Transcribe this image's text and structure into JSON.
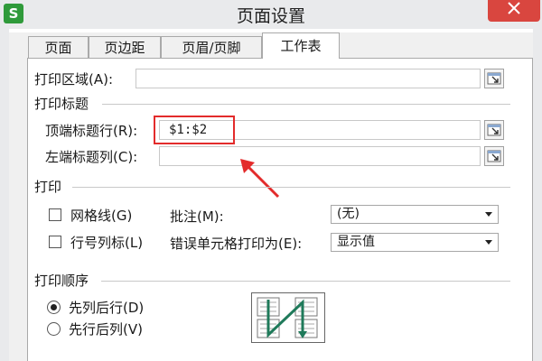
{
  "window": {
    "title": "页面设置",
    "app_icon_letter": "S"
  },
  "tabs": [
    {
      "label": "页面",
      "active": false
    },
    {
      "label": "页边距",
      "active": false
    },
    {
      "label": "页眉/页脚",
      "active": false
    },
    {
      "label": "工作表",
      "active": true
    }
  ],
  "print_area": {
    "label": "打印区域(A):",
    "value": ""
  },
  "print_titles": {
    "section_label": "打印标题",
    "top_rows": {
      "label": "顶端标题行(R):",
      "value": "$1:$2"
    },
    "left_cols": {
      "label": "左端标题列(C):",
      "value": ""
    }
  },
  "print": {
    "section_label": "打印",
    "gridlines": {
      "label": "网格线(G)",
      "checked": false
    },
    "row_col_headings": {
      "label": "行号列标(L)",
      "checked": false
    },
    "comments": {
      "label": "批注(M):",
      "value": "(无)"
    },
    "cell_errors": {
      "label": "错误单元格打印为(E):",
      "value": "显示值"
    }
  },
  "print_order": {
    "section_label": "打印顺序",
    "down_then_over": {
      "label": "先列后行(D)",
      "selected": true
    },
    "over_then_down": {
      "label": "先行后列(V)",
      "selected": false
    }
  },
  "colors": {
    "accent_red": "#e32b2b",
    "close_red": "#d9463f",
    "app_green": "#2f9a3a"
  },
  "icons": [
    "app-icon",
    "close-icon",
    "range-picker-icon",
    "print-order-preview-icon"
  ]
}
